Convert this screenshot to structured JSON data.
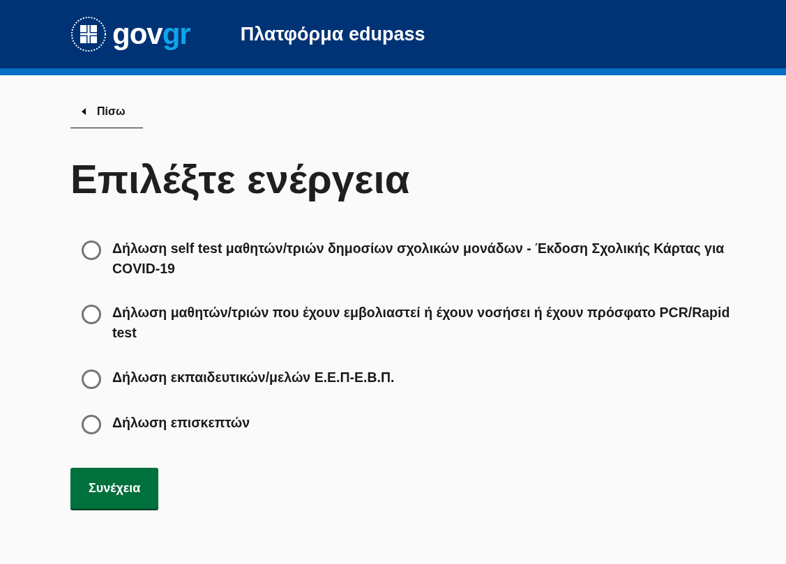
{
  "header": {
    "logo": {
      "text_main": "gov",
      "text_accent": "gr"
    },
    "title": "Πλατφόρμα edupass"
  },
  "back_link": {
    "label": "Πίσω"
  },
  "heading": "Επιλέξτε ενέργεια",
  "options": [
    {
      "label": "Δήλωση self test μαθητών/τριών δημοσίων σχολικών μονάδων - Έκδοση Σχολικής Κάρτας για COVID-19",
      "selected": false
    },
    {
      "label": "Δήλωση μαθητών/τριών που έχουν εμβολιαστεί ή έχουν νοσήσει ή έχουν πρόσφατο PCR/Rapid test",
      "selected": false
    },
    {
      "label": "Δήλωση εκπαιδευτικών/μελών Ε.Ε.Π-Ε.Β.Π.",
      "selected": false
    },
    {
      "label": "Δήλωση επισκεπτών",
      "selected": false
    }
  ],
  "continue_button": {
    "label": "Συνέχεια"
  }
}
